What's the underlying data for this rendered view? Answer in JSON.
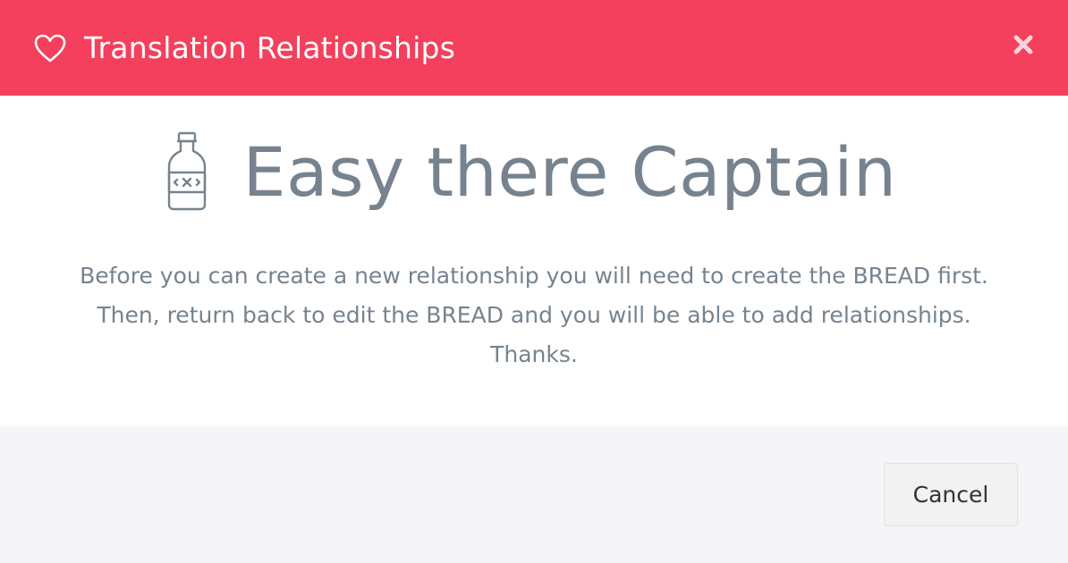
{
  "colors": {
    "header_bg": "#f4405d",
    "header_text": "#ffffff",
    "body_text": "#76838f",
    "footer_bg": "#f5f5f7",
    "button_bg": "#f2f2f2"
  },
  "header": {
    "icon": "heart-outline-icon",
    "title": "Translation Relationships",
    "close_icon": "close-icon"
  },
  "body": {
    "icon": "poison-bottle-icon",
    "headline": "Easy there Captain",
    "message_lines": [
      "Before you can create a new relationship you will need to create the BREAD first.",
      "Then, return back to edit the BREAD and you will be able to add relationships.",
      "Thanks."
    ]
  },
  "footer": {
    "cancel_label": "Cancel"
  }
}
